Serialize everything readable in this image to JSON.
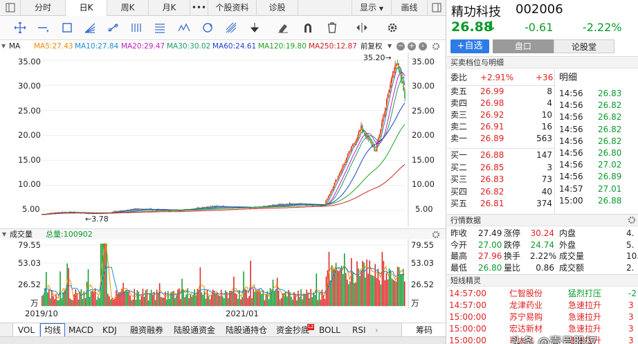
{
  "tabs": [
    "分时",
    "日K",
    "周K",
    "月K",
    "•••",
    "个股资料",
    "诊股",
    "显示",
    "画线"
  ],
  "active_tab": "日K",
  "toolbar_icons": [
    "crosshair-icon",
    "line-icon",
    "rect-icon",
    "fan-icon",
    "ray-icon",
    "parallel-icon",
    "channel-icon",
    "wave-icon",
    "cycle-icon",
    "gann-icon",
    "arrow-down-icon",
    "eraser-icon",
    "magnet-icon",
    "trash-icon",
    "expand-icon",
    "settings-icon"
  ],
  "ma": {
    "label": "MA",
    "items": [
      {
        "text": "MA5:27.43",
        "color": "#f08a00"
      },
      {
        "text": "MA10:27.84",
        "color": "#1a8ad8"
      },
      {
        "text": "MA20:29.47",
        "color": "#c020c0"
      },
      {
        "text": "MA30:30.02",
        "color": "#1a9a60"
      },
      {
        "text": "MA60:24.61",
        "color": "#2040d0"
      },
      {
        "text": "MA120:19.80",
        "color": "#20a020"
      },
      {
        "text": "MA250:12.87",
        "color": "#d02020"
      }
    ],
    "fuquan": "前复权"
  },
  "price_axis": {
    "ticks": [
      "35.00",
      "30.00",
      "25.00",
      "20.00",
      "15.00",
      "10.00",
      "5.00"
    ]
  },
  "annotations": {
    "high": "35.20→",
    "low": "←3.78"
  },
  "volume": {
    "label": "成交量",
    "total": "总量:100902",
    "ticks": [
      "79.55",
      "53.03",
      "26.52"
    ],
    "unit": "万"
  },
  "x_labels": [
    "2019/10",
    "2021/01"
  ],
  "bottom_tabs": [
    "VOL",
    "均线",
    "MACD",
    "KDJ",
    "融资融券",
    "陆股通资金",
    "陆股通持仓",
    "资金抄底",
    "BOLL",
    "RSI",
    "筹码"
  ],
  "badge": "L2",
  "stock": {
    "name": "精功科技",
    "code": "002006",
    "price": "26.88",
    "arrow": "↓",
    "change": "-0.61",
    "pct": "-2.22%"
  },
  "buttons": {
    "add": "+自选",
    "tab1": "盘口",
    "tab2": "论股堂"
  },
  "orderbook_title": "买卖档位与明细",
  "weibi": {
    "label": "委比",
    "pct": "+2.91%",
    "diff": "+36"
  },
  "detail_title": "明细",
  "asks": [
    {
      "label": "卖五",
      "price": "26.99",
      "vol": "8"
    },
    {
      "label": "卖四",
      "price": "26.98",
      "vol": "4"
    },
    {
      "label": "卖三",
      "price": "26.92",
      "vol": "10"
    },
    {
      "label": "卖二",
      "price": "26.91",
      "vol": "16"
    },
    {
      "label": "卖一",
      "price": "26.89",
      "vol": "563"
    }
  ],
  "bids": [
    {
      "label": "买一",
      "price": "26.88",
      "vol": "147"
    },
    {
      "label": "买二",
      "price": "26.85",
      "vol": "3"
    },
    {
      "label": "买三",
      "price": "26.83",
      "vol": "73"
    },
    {
      "label": "买四",
      "price": "26.82",
      "vol": "40"
    },
    {
      "label": "买五",
      "price": "26.81",
      "vol": "374"
    }
  ],
  "details": [
    {
      "time": "14:56",
      "price": "26.83",
      "color": "green"
    },
    {
      "time": "14:56",
      "price": "26.82",
      "color": "green"
    },
    {
      "time": "14:56",
      "price": "26.82",
      "color": "green"
    },
    {
      "time": "14:56",
      "price": "26.82",
      "color": "green"
    },
    {
      "time": "14:56",
      "price": "26.82",
      "color": "green"
    },
    {
      "time": "14:56",
      "price": "26.80",
      "color": "green"
    },
    {
      "time": "14:56",
      "price": "27.02",
      "color": "green"
    },
    {
      "time": "14:56",
      "price": "26.89",
      "color": "green"
    },
    {
      "time": "14:57",
      "price": "27.01",
      "color": "green"
    },
    {
      "time": "15:00",
      "price": "26.88",
      "color": "green"
    }
  ],
  "market_title": "行情数据",
  "market": [
    {
      "k1": "昨收",
      "v1": "27.49",
      "c1": "",
      "k2": "涨停",
      "v2": "30.24",
      "c2": "red",
      "k3": "内盘",
      "v3": "4."
    },
    {
      "k1": "今开",
      "v1": "27.00",
      "c1": "green",
      "k2": "跌停",
      "v2": "24.74",
      "c2": "green",
      "k3": "外盘",
      "v3": "5."
    },
    {
      "k1": "最高",
      "v1": "27.96",
      "c1": "red",
      "k2": "换手",
      "v2": "2.22%",
      "c2": "",
      "k3": "成交量",
      "v3": "10."
    },
    {
      "k1": "最低",
      "v1": "26.80",
      "c1": "green",
      "k2": "量比",
      "v2": "0.86",
      "c2": "",
      "k3": "成交额",
      "v3": "2."
    }
  ],
  "news_title": "短线精灵",
  "news": [
    {
      "time": "14:57:00",
      "name": "仁智股份",
      "event": "猛烈打压",
      "val": "-2"
    },
    {
      "time": "14:57:00",
      "name": "龙津药业",
      "event": "急速拉升",
      "val": "3"
    },
    {
      "time": "15:00:00",
      "name": "苏宁易购",
      "event": "急速拉升",
      "val": "3"
    },
    {
      "time": "15:00:00",
      "name": "宏达新材",
      "event": "急速拉升",
      "val": "3"
    },
    {
      "time": "15:00:00",
      "name": "司太立",
      "event": "急速拉升",
      "val": "3"
    }
  ],
  "watermark": "头条 @壹号股权"
}
